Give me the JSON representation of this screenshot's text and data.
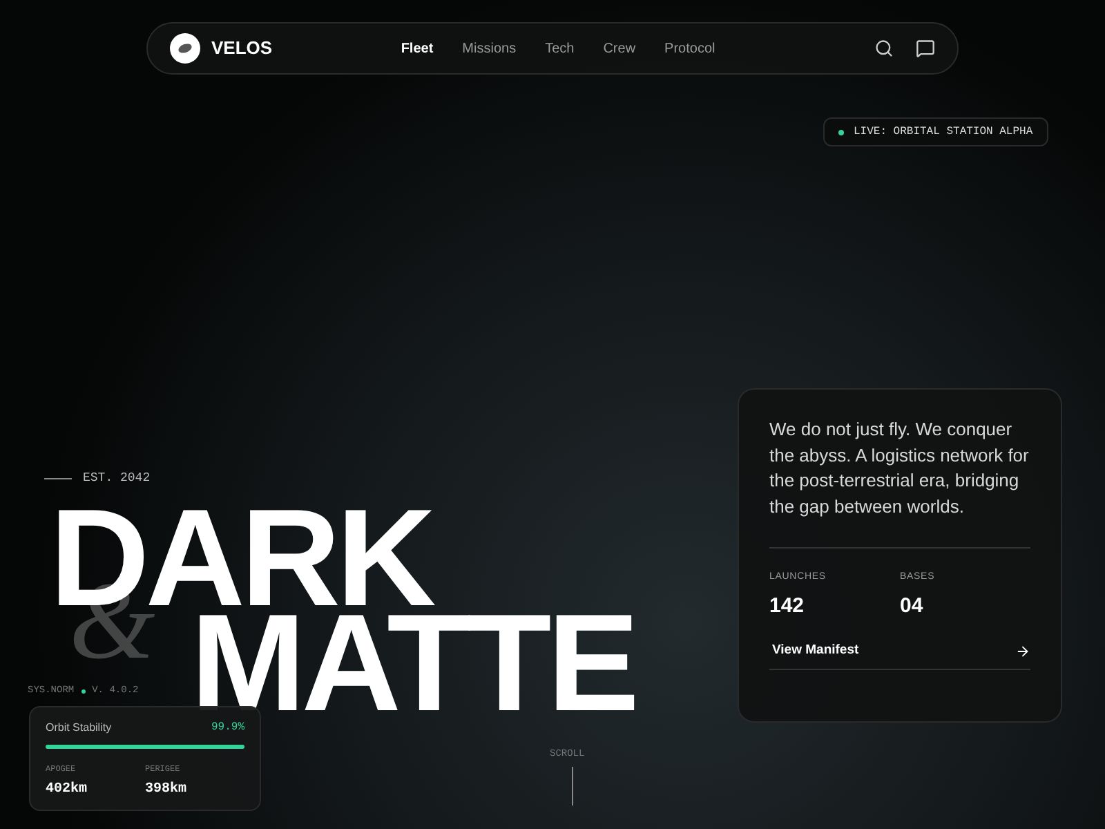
{
  "nav": {
    "brand": "VELOS",
    "links": [
      {
        "label": "Fleet",
        "selected": true
      },
      {
        "label": "Missions",
        "selected": false
      },
      {
        "label": "Tech",
        "selected": false
      },
      {
        "label": "Crew",
        "selected": false
      },
      {
        "label": "Protocol",
        "selected": false
      }
    ]
  },
  "live_badge": {
    "text": "LIVE: ORBITAL STATION ALPHA",
    "on": true
  },
  "hero": {
    "established": "EST. 2042",
    "title_lines": [
      "DARK",
      "MATTE"
    ],
    "ampersand": "&",
    "system": "SYS.NORM",
    "version": "V. 4.0.2",
    "scroll": "SCROLL"
  },
  "info_card": {
    "text": "We do not just fly. We conquer the abyss. A logistics network for the post-terrestrial era, bridging the gap between worlds.",
    "stats": [
      {
        "label": "LAUNCHES",
        "value": "142"
      },
      {
        "label": "BASES",
        "value": "04"
      }
    ],
    "link": "View Manifest"
  },
  "stability_card": {
    "label": "Orbit Stability",
    "reading": "99.9%",
    "level": 0.999,
    "stats": [
      {
        "label": "APOGEE",
        "value": "402km"
      },
      {
        "label": "PERIGEE",
        "value": "398km"
      }
    ]
  }
}
